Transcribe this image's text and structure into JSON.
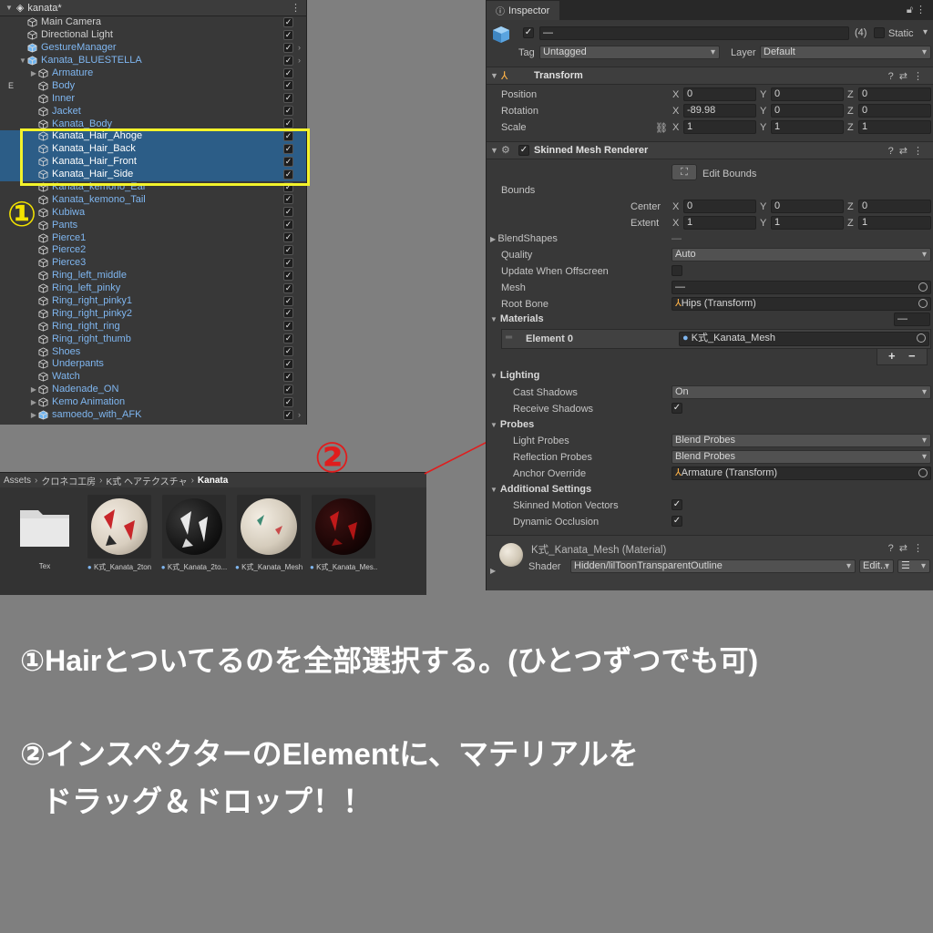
{
  "hierarchy": {
    "scene": "kanata*",
    "items": [
      {
        "name": "Main Camera",
        "depth": 1,
        "blue": false,
        "arrow": false,
        "selected": false,
        "prefab": false
      },
      {
        "name": "Directional Light",
        "depth": 1,
        "blue": false,
        "arrow": false,
        "selected": false,
        "prefab": false
      },
      {
        "name": "GestureManager",
        "depth": 1,
        "blue": true,
        "arrow": false,
        "selected": false,
        "prefab": true
      },
      {
        "name": "Kanata_BLUESTELLA",
        "depth": 1,
        "blue": true,
        "arrow": "down",
        "selected": false,
        "prefab": true
      },
      {
        "name": "Armature",
        "depth": 2,
        "blue": true,
        "arrow": "right",
        "selected": false,
        "prefab": false
      },
      {
        "name": "Body",
        "depth": 2,
        "blue": true,
        "arrow": false,
        "selected": false,
        "prefab": false
      },
      {
        "name": "Inner",
        "depth": 2,
        "blue": true,
        "arrow": false,
        "selected": false,
        "prefab": false
      },
      {
        "name": "Jacket",
        "depth": 2,
        "blue": true,
        "arrow": false,
        "selected": false,
        "prefab": false
      },
      {
        "name": "Kanata_Body",
        "depth": 2,
        "blue": true,
        "arrow": false,
        "selected": false,
        "prefab": false
      },
      {
        "name": "Kanata_Hair_Ahoge",
        "depth": 2,
        "blue": true,
        "arrow": false,
        "selected": true,
        "prefab": false
      },
      {
        "name": "Kanata_Hair_Back",
        "depth": 2,
        "blue": true,
        "arrow": false,
        "selected": true,
        "prefab": false
      },
      {
        "name": "Kanata_Hair_Front",
        "depth": 2,
        "blue": true,
        "arrow": false,
        "selected": true,
        "prefab": false
      },
      {
        "name": "Kanata_Hair_Side",
        "depth": 2,
        "blue": true,
        "arrow": false,
        "selected": true,
        "prefab": false
      },
      {
        "name": "Kanata_kemono_Ear",
        "depth": 2,
        "blue": true,
        "arrow": false,
        "selected": false,
        "prefab": false
      },
      {
        "name": "Kanata_kemono_Tail",
        "depth": 2,
        "blue": true,
        "arrow": false,
        "selected": false,
        "prefab": false
      },
      {
        "name": "Kubiwa",
        "depth": 2,
        "blue": true,
        "arrow": false,
        "selected": false,
        "prefab": false
      },
      {
        "name": "Pants",
        "depth": 2,
        "blue": true,
        "arrow": false,
        "selected": false,
        "prefab": false
      },
      {
        "name": "Pierce1",
        "depth": 2,
        "blue": true,
        "arrow": false,
        "selected": false,
        "prefab": false
      },
      {
        "name": "Pierce2",
        "depth": 2,
        "blue": true,
        "arrow": false,
        "selected": false,
        "prefab": false
      },
      {
        "name": "Pierce3",
        "depth": 2,
        "blue": true,
        "arrow": false,
        "selected": false,
        "prefab": false
      },
      {
        "name": "Ring_left_middle",
        "depth": 2,
        "blue": true,
        "arrow": false,
        "selected": false,
        "prefab": false
      },
      {
        "name": "Ring_left_pinky",
        "depth": 2,
        "blue": true,
        "arrow": false,
        "selected": false,
        "prefab": false
      },
      {
        "name": "Ring_right_pinky1",
        "depth": 2,
        "blue": true,
        "arrow": false,
        "selected": false,
        "prefab": false
      },
      {
        "name": "Ring_right_pinky2",
        "depth": 2,
        "blue": true,
        "arrow": false,
        "selected": false,
        "prefab": false
      },
      {
        "name": "Ring_right_ring",
        "depth": 2,
        "blue": true,
        "arrow": false,
        "selected": false,
        "prefab": false
      },
      {
        "name": "Ring_right_thumb",
        "depth": 2,
        "blue": true,
        "arrow": false,
        "selected": false,
        "prefab": false
      },
      {
        "name": "Shoes",
        "depth": 2,
        "blue": true,
        "arrow": false,
        "selected": false,
        "prefab": false
      },
      {
        "name": "Underpants",
        "depth": 2,
        "blue": true,
        "arrow": false,
        "selected": false,
        "prefab": false
      },
      {
        "name": "Watch",
        "depth": 2,
        "blue": true,
        "arrow": false,
        "selected": false,
        "prefab": false
      },
      {
        "name": "Nadenade_ON",
        "depth": 2,
        "blue": true,
        "arrow": "right",
        "selected": false,
        "prefab": false
      },
      {
        "name": "Kemo Animation",
        "depth": 2,
        "blue": true,
        "arrow": "right",
        "selected": false,
        "prefab": false
      },
      {
        "name": "samoedo_with_AFK",
        "depth": 2,
        "blue": true,
        "arrow": "right",
        "selected": false,
        "prefab": true
      }
    ]
  },
  "callouts": {
    "one": "①",
    "two": "②"
  },
  "project": {
    "breadcrumb": [
      "Assets",
      "クロネコ工房",
      "K式 ヘアテクスチャ",
      "Kanata"
    ],
    "assets": [
      {
        "label": "Tex",
        "kind": "folder"
      },
      {
        "label": "K式_Kanata_2ton",
        "kind": "mat",
        "style": "light-red"
      },
      {
        "label": "K式_Kanata_2to...",
        "kind": "mat",
        "style": "dark-white"
      },
      {
        "label": "K式_Kanata_Mesh",
        "kind": "mat",
        "style": "light"
      },
      {
        "label": "K式_Kanata_Mes...",
        "kind": "mat",
        "style": "dark-red"
      }
    ]
  },
  "inspector": {
    "tab": "Inspector",
    "object_name": "—",
    "count": "(4)",
    "static_label": "Static",
    "tag_label": "Tag",
    "tag_value": "Untagged",
    "layer_label": "Layer",
    "layer_value": "Default",
    "transform": {
      "title": "Transform",
      "position_label": "Position",
      "position": [
        "0",
        "0",
        "0"
      ],
      "rotation_label": "Rotation",
      "rotation": [
        "-89.98",
        "0",
        "0"
      ],
      "scale_label": "Scale",
      "scale": [
        "1",
        "1",
        "1"
      ]
    },
    "axes": [
      "X",
      "Y",
      "Z"
    ],
    "smr": {
      "title": "Skinned Mesh Renderer",
      "edit_bounds": "Edit Bounds",
      "bounds_label": "Bounds",
      "center_label": "Center",
      "center": [
        "0",
        "0",
        "0"
      ],
      "extent_label": "Extent",
      "extent": [
        "1",
        "1",
        "1"
      ],
      "blendshapes_label": "BlendShapes",
      "blendshapes_value": "—",
      "quality_label": "Quality",
      "quality_value": "Auto",
      "update_offscreen_label": "Update When Offscreen",
      "mesh_label": "Mesh",
      "mesh_value": "—",
      "root_bone_label": "Root Bone",
      "root_bone_value": "Hips (Transform)",
      "materials_label": "Materials",
      "materials_count": "—",
      "element_label": "Element 0",
      "element_value": "K式_Kanata_Mesh",
      "plus": "+",
      "minus": "−",
      "lighting_label": "Lighting",
      "cast_shadows_label": "Cast Shadows",
      "cast_shadows_value": "On",
      "receive_shadows_label": "Receive Shadows",
      "probes_label": "Probes",
      "light_probes_label": "Light Probes",
      "light_probes_value": "Blend Probes",
      "reflection_probes_label": "Reflection Probes",
      "reflection_probes_value": "Blend Probes",
      "anchor_override_label": "Anchor Override",
      "anchor_override_value": "Armature (Transform)",
      "additional_label": "Additional Settings",
      "motion_vectors_label": "Skinned Motion Vectors",
      "dynamic_occlusion_label": "Dynamic Occlusion"
    },
    "material": {
      "title": "K式_Kanata_Mesh (Material)",
      "shader_label": "Shader",
      "shader_value": "Hidden/lilToonTransparentOutline",
      "edit_label": "Edit..."
    }
  },
  "instructions": {
    "line1": "①Hairとついてるのを全部選択する。(ひとつずつでも可)",
    "line2": "②インスペクターのElementに、マテリアルを",
    "line3": "ドラッグ＆ドロップ！！"
  },
  "colors": {
    "highlight_box": "#f3f32b",
    "callout_two": "#e01d1d",
    "selection": "#2c5d87",
    "callout_one": "#f3e300"
  }
}
